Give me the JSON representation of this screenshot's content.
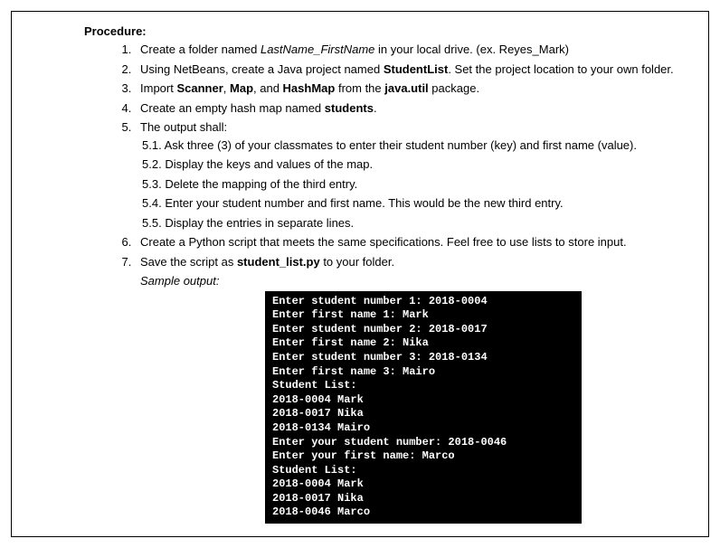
{
  "title": "Procedure:",
  "steps": [
    {
      "pre": "Create a folder named ",
      "em1": "LastName_FirstName",
      "post": " in your local drive. (ex. Reyes_Mark)"
    },
    {
      "pre": "Using NetBeans, create a Java project named ",
      "b1": "StudentList",
      "post": ". Set the project location to your own folder."
    },
    {
      "pre": "Import ",
      "b1": "Scanner",
      "mid1": ", ",
      "b2": "Map",
      "mid2": ", and ",
      "b3": "HashMap",
      "mid3": " from the ",
      "b4": "java.util",
      "post": " package."
    },
    {
      "pre": "Create an empty hash map named ",
      "b1": "students",
      "post": "."
    },
    {
      "text": "The output shall:"
    },
    {
      "sub": [
        {
          "num": "5.1.",
          "text": "Ask three (3) of your classmates to enter their student number (key) and first name (value)."
        },
        {
          "num": "5.2.",
          "text": "Display the keys and values of the map."
        },
        {
          "num": "5.3.",
          "text": "Delete the mapping of the third entry."
        },
        {
          "num": "5.4.",
          "text": "Enter your student number and first name. This would be the new third entry."
        },
        {
          "num": "5.5.",
          "text": "Display the entries in separate lines."
        }
      ]
    },
    {
      "text": "Create a Python script that meets the same specifications. Feel free to use lists to store input."
    },
    {
      "pre": "Save the script as ",
      "b1": "student_list.py",
      "post": " to your folder."
    }
  ],
  "sample_label": "Sample output:",
  "console": "Enter student number 1: 2018-0004\nEnter first name 1: Mark\nEnter student number 2: 2018-0017\nEnter first name 2: Nika\nEnter student number 3: 2018-0134\nEnter first name 3: Mairo\nStudent List:\n2018-0004 Mark\n2018-0017 Nika\n2018-0134 Mairo\nEnter your student number: 2018-0046\nEnter your first name: Marco\nStudent List:\n2018-0004 Mark\n2018-0017 Nika\n2018-0046 Marco"
}
